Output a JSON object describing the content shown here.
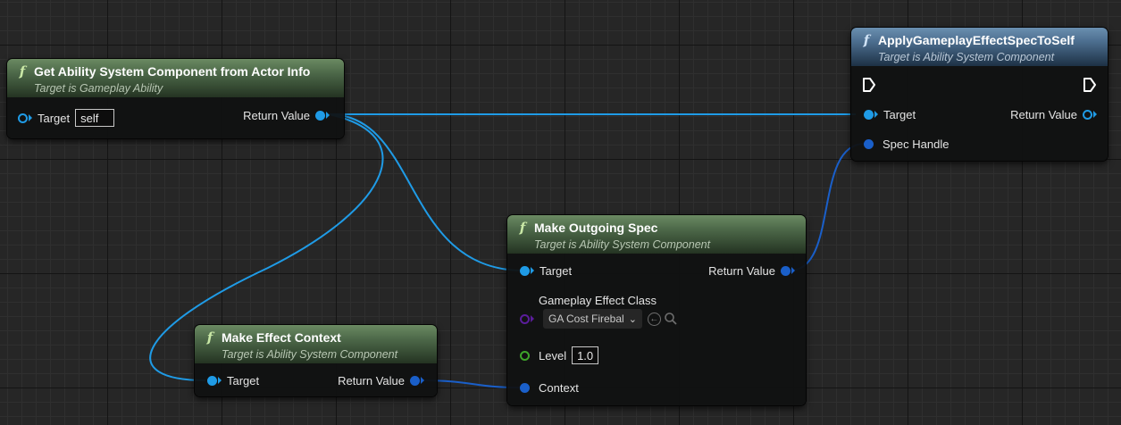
{
  "graph": {
    "nodes": {
      "get_asc": {
        "title": "Get Ability System Component from Actor Info",
        "subtitle": "Target is Gameplay Ability",
        "icon": "function-icon",
        "header_color": "#4e6a4a",
        "inputs": {
          "target_label": "Target",
          "target_value": "self"
        },
        "outputs": {
          "return_label": "Return Value"
        }
      },
      "apply_effect": {
        "title": "ApplyGameplayEffectSpecToSelf",
        "subtitle": "Target is Ability System Component",
        "icon": "function-icon",
        "header_color": "#4d6f90",
        "inputs": {
          "target_label": "Target",
          "spec_handle_label": "Spec Handle"
        },
        "outputs": {
          "return_label": "Return Value"
        }
      },
      "make_spec": {
        "title": "Make Outgoing Spec",
        "subtitle": "Target is Ability System Component",
        "icon": "function-icon",
        "header_color": "#4e6a4a",
        "inputs": {
          "target_label": "Target",
          "effect_class_label": "Gameplay Effect Class",
          "effect_class_value": "GA Cost Firebal",
          "level_label": "Level",
          "level_value": "1.0",
          "context_label": "Context"
        },
        "outputs": {
          "return_label": "Return Value"
        }
      },
      "make_context": {
        "title": "Make Effect Context",
        "subtitle": "Target is Ability System Component",
        "icon": "function-icon",
        "header_color": "#4e6a4a",
        "inputs": {
          "target_label": "Target"
        },
        "outputs": {
          "return_label": "Return Value"
        }
      }
    },
    "colors": {
      "object_pin": "#1f9be6",
      "struct_pin": "#1a5fc9",
      "class_pin": "#5a1d9a",
      "float_pin": "#3ea52a"
    }
  }
}
